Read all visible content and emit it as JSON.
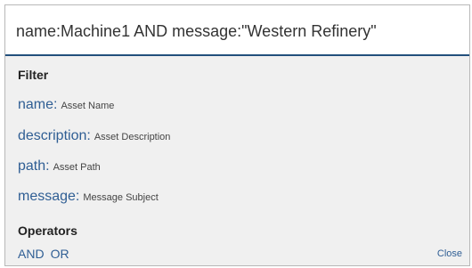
{
  "query": {
    "value": "name:Machine1 AND message:\"Western Refinery\""
  },
  "filter": {
    "title": "Filter",
    "items": [
      {
        "key": "name:",
        "description": "Asset Name"
      },
      {
        "key": "description:",
        "description": "Asset Description"
      },
      {
        "key": "path:",
        "description": "Asset Path"
      },
      {
        "key": "message:",
        "description": "Message Subject"
      }
    ]
  },
  "operators": {
    "title": "Operators",
    "items": [
      "AND",
      "OR"
    ]
  },
  "close_label": "Close",
  "colors": {
    "link": "#2f5e94",
    "accent_border": "#22507c",
    "panel_bg": "#f0f0f0"
  }
}
